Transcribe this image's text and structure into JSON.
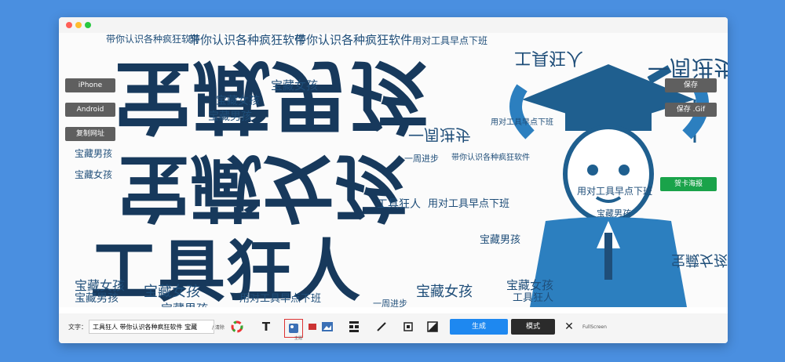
{
  "window": {
    "dot_colors": [
      "#ff5f57",
      "#febc2e",
      "#28c840"
    ]
  },
  "left_buttons": {
    "iphone": "iPhone",
    "android": "Android",
    "copy_url": "复制网址"
  },
  "right_buttons": {
    "save": "保存",
    "save_gif": "保存 .Gif",
    "poster": "贺卡海报"
  },
  "cloud_words": {
    "w1": "宝藏女孩",
    "w2": "宝藏男孩",
    "w3": "工具狂人",
    "w4": "一周进步",
    "w5": "用对工具早点下班",
    "w6": "带你认识各种疯狂软件",
    "w7": "宝藏男孩",
    "big1": "宝藏男孩",
    "big2": "宝藏女孩",
    "big3": "工具狂人"
  },
  "toolbar": {
    "text_label": "文字：",
    "text_input_value": "工具狂人 带你认识各种疯狂软件 宝藏",
    "clear_label": "/ 清除",
    "generate_label": "生成",
    "mode_label": "模式",
    "fullscreen_label": "FullScreen",
    "tooltip_label": "主题"
  },
  "colors": {
    "accent": "#1e88f0",
    "word_color": "#1f4e79",
    "poster_green": "#1aa34a"
  }
}
